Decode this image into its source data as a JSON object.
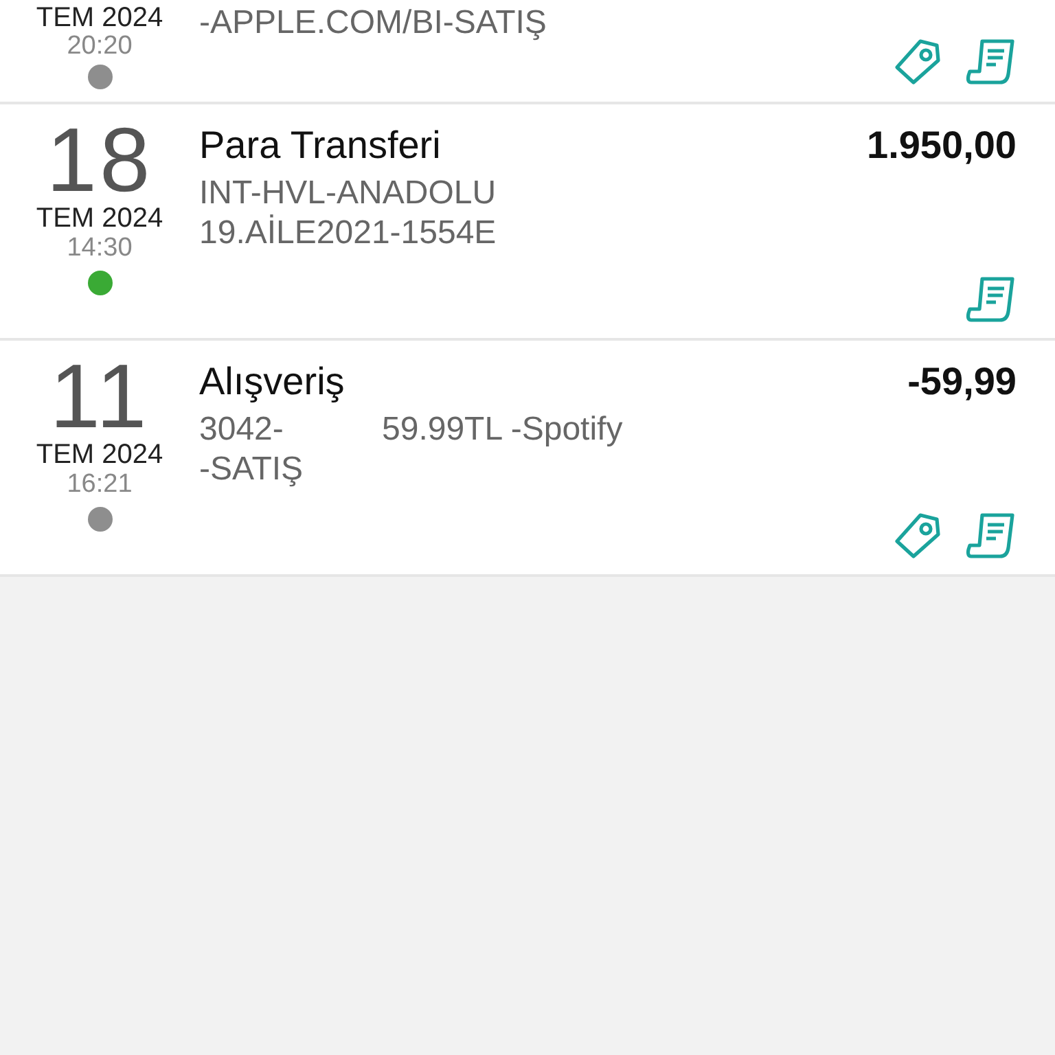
{
  "transactions": [
    {
      "month": "TEM 2024",
      "time": "20:20",
      "color": "#8e8e8e",
      "lines": [
        [
          "-APPLE.COM/BI-SATIŞ"
        ]
      ],
      "icons": [
        {
          "kind": "tag"
        },
        {
          "kind": "receipt"
        }
      ]
    },
    {
      "day": "18",
      "month": "TEM 2024",
      "time": "14:30",
      "color": "#3aaa35",
      "title": "Para Transferi",
      "amount": "1.950,00",
      "lines": [
        [
          "INT-HVL-ANADOLU"
        ],
        [
          "19.AİLE2021-1554E"
        ]
      ],
      "icons": [
        {
          "kind": "receipt"
        }
      ]
    },
    {
      "day": "11",
      "month": "TEM 2024",
      "time": "16:21",
      "color": "#8e8e8e",
      "title": "Alışveriş",
      "amount": "-59,99",
      "lines": [
        [
          "3042-",
          "59.99TL -Spotify"
        ],
        [
          "-SATIŞ"
        ]
      ],
      "icons": [
        {
          "kind": "tag"
        },
        {
          "kind": "receipt"
        }
      ]
    }
  ]
}
